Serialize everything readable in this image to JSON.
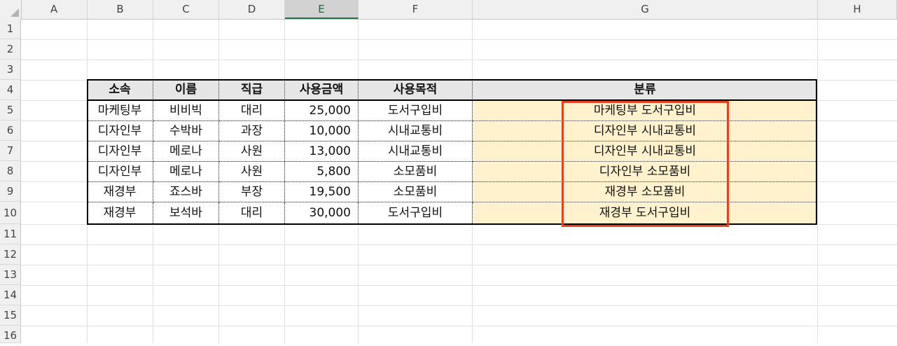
{
  "sheet": {
    "columns": [
      "A",
      "B",
      "C",
      "D",
      "E",
      "F",
      "G",
      "H"
    ],
    "selected_column": "E",
    "rows": [
      "1",
      "2",
      "3",
      "4",
      "5",
      "6",
      "7",
      "8",
      "9",
      "10",
      "11",
      "12",
      "13",
      "14",
      "15",
      "16"
    ]
  },
  "table": {
    "headers": [
      "소속",
      "이름",
      "직급",
      "사용금액",
      "사용목적",
      "분류"
    ],
    "rows": [
      [
        "마케팅부",
        "비비빅",
        "대리",
        "25,000",
        "도서구입비",
        "마케팅부 도서구입비"
      ],
      [
        "디자인부",
        "수박바",
        "과장",
        "10,000",
        "시내교통비",
        "디자인부 시내교통비"
      ],
      [
        "디자인부",
        "메로나",
        "사원",
        "13,000",
        "시내교통비",
        "디자인부 시내교통비"
      ],
      [
        "디자인부",
        "메로나",
        "사원",
        "5,800",
        "소모품비",
        "디자인부 소모품비"
      ],
      [
        "재경부",
        "죠스바",
        "부장",
        "19,500",
        "소모품비",
        "재경부 소모품비"
      ],
      [
        "재경부",
        "보석바",
        "대리",
        "30,000",
        "도서구입비",
        "재경부 도서구입비"
      ]
    ]
  },
  "colors": {
    "highlight_fill": "#fff2cc",
    "header_fill": "#e7e6e6",
    "annotation_box": "#e8411e",
    "selected_col_accent": "#217346"
  }
}
